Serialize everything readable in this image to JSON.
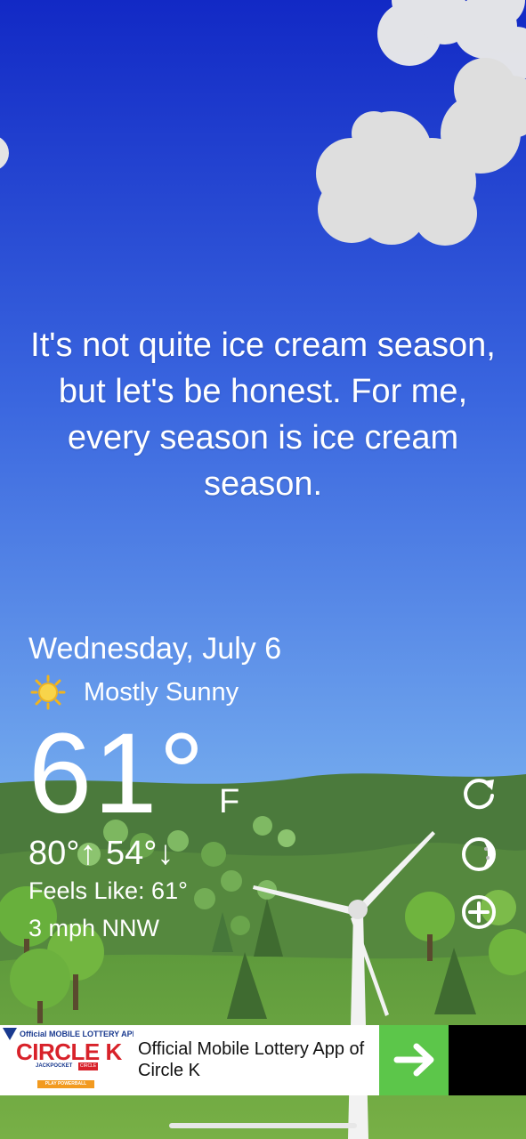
{
  "quote": "It's not quite ice cream season, but let's be honest. For me, every season is ice cream season.",
  "weather": {
    "date": "Wednesday, July 6",
    "condition": "Mostly Sunny",
    "condition_icon": "sun-icon",
    "temperature": "61°",
    "unit": "F",
    "hi_lo": "80°↑ 54°↓",
    "feels_like": "Feels Like: 61°",
    "wind": "3 mph NNW"
  },
  "side_buttons": [
    {
      "icon": "refresh-icon"
    },
    {
      "icon": "moon-phase-icon"
    },
    {
      "icon": "add-icon"
    }
  ],
  "ad": {
    "logo_top": "Official MOBILE LOTTERY APP of",
    "logo_brand": "CIRCLE K",
    "logo_sub1": "JACKPOCKET",
    "logo_sub2": "CIRCLE K",
    "logo_play": "PLAY POWERBALL",
    "text": "Official Mobile Lottery App of Circle K",
    "cta_icon": "arrow-right-icon"
  },
  "colors": {
    "sky_top": "#1530c8",
    "sky_bottom": "#7cb8ee",
    "hill": "#4a7a3a",
    "grass": "#6aa240",
    "ad_cta": "#5cc64a"
  }
}
